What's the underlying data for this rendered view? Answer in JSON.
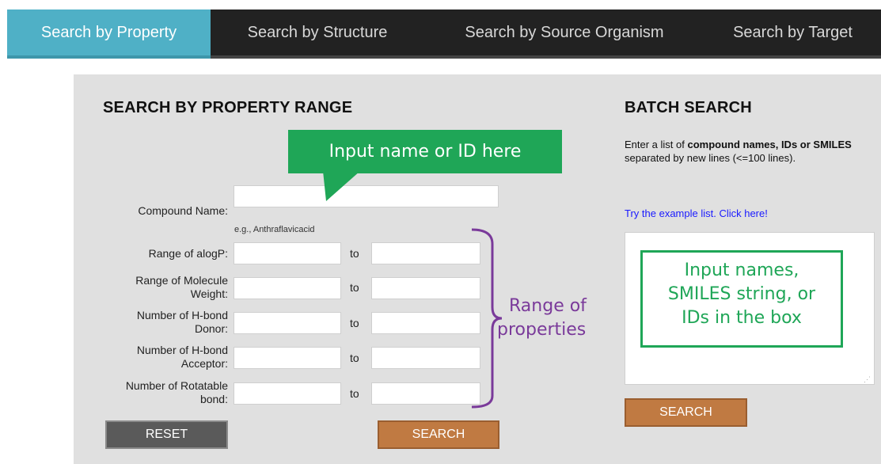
{
  "tabs": [
    {
      "label": "Search by Property"
    },
    {
      "label": "Search by Structure"
    },
    {
      "label": "Search by Source Organism"
    },
    {
      "label": "Search by Target"
    }
  ],
  "property": {
    "heading": "SEARCH BY PROPERTY RANGE",
    "compound_label": "Compound Name:",
    "compound_value": "",
    "hint": "e.g., Anthraflavicacid",
    "to": "to",
    "rows": [
      {
        "label_1": "Range of alogP:",
        "label_2": ""
      },
      {
        "label_1": "Range of Molecule",
        "label_2": "Weight:"
      },
      {
        "label_1": "Number of H-bond",
        "label_2": "Donor:"
      },
      {
        "label_1": "Number of H-bond",
        "label_2": "Acceptor:"
      },
      {
        "label_1": "Number of Rotatable",
        "label_2": "bond:"
      }
    ],
    "reset_label": "RESET",
    "search_label": "SEARCH"
  },
  "batch": {
    "heading": "BATCH SEARCH",
    "desc_1": "Enter a list of ",
    "desc_bold": "compound names, IDs or SMILES",
    "desc_2": " separated by new lines (<=100 lines).",
    "example_link": "Try the example list. Click here!",
    "textarea_value": "",
    "search_label": "SEARCH"
  },
  "annotations": {
    "callout_name": "Input name or ID here",
    "range_1": "Range of",
    "range_2": "properties",
    "box_note_1": "Input names,",
    "box_note_2": "SMILES string, or",
    "box_note_3": "IDs in the box"
  },
  "colors": {
    "active_tab": "#4fb0c6",
    "inactive_tab": "#222222",
    "panel_bg": "#e0e0e0",
    "search_button": "#c07a42",
    "reset_button": "#5a5a5a",
    "annotation_green": "#1fa657",
    "annotation_purple": "#7a3a9a",
    "link_blue": "#1a1aff"
  }
}
